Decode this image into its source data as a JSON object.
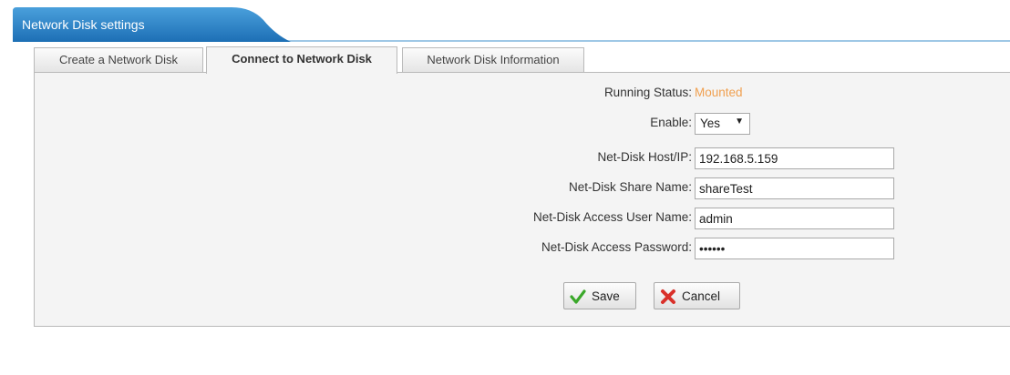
{
  "header": {
    "title": "Network Disk settings"
  },
  "tabs": [
    {
      "label": "Create a Network Disk",
      "active": false
    },
    {
      "label": "Connect to Network Disk",
      "active": true
    },
    {
      "label": "Network Disk Information",
      "active": false
    }
  ],
  "form": {
    "running_status": {
      "label": "Running Status:",
      "value": "Mounted",
      "color": "#f0a050"
    },
    "enable": {
      "label": "Enable:",
      "value": "Yes"
    },
    "host": {
      "label": "Net-Disk Host/IP:",
      "value": "192.168.5.159"
    },
    "share_name": {
      "label": "Net-Disk Share Name:",
      "value": "shareTest"
    },
    "user_name": {
      "label": "Net-Disk Access User Name:",
      "value": "admin"
    },
    "password": {
      "label": "Net-Disk Access Password:",
      "value": "••••••"
    }
  },
  "buttons": {
    "save_label": "Save",
    "cancel_label": "Cancel"
  },
  "icons": {
    "save": "checkmark-icon",
    "cancel": "x-icon"
  },
  "colors": {
    "header_blue": "#2c83c7",
    "accent_status": "#f0a050"
  }
}
